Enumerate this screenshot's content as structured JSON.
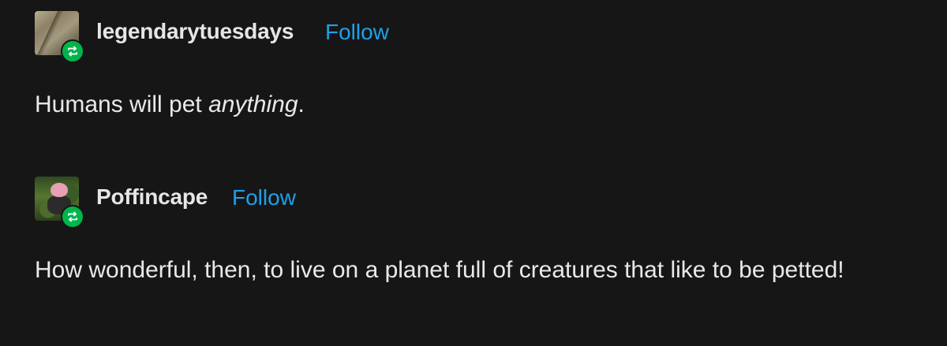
{
  "posts": [
    {
      "username": "legendarytuesdays",
      "follow_label": "Follow",
      "avatar_icon": "user-avatar",
      "badge_icon": "reblog-icon",
      "text_before": "Humans will pet ",
      "text_emphasis": "anything",
      "text_after": "."
    },
    {
      "username": "Poffincape",
      "follow_label": "Follow",
      "avatar_icon": "user-avatar",
      "badge_icon": "reblog-icon",
      "text": "How wonderful, then, to live on a planet full of creatures that like to be petted!"
    }
  ],
  "colors": {
    "background": "#161616",
    "text": "#e9e9e9",
    "follow": "#1fa0ea",
    "reblog_badge": "#00b44c"
  }
}
